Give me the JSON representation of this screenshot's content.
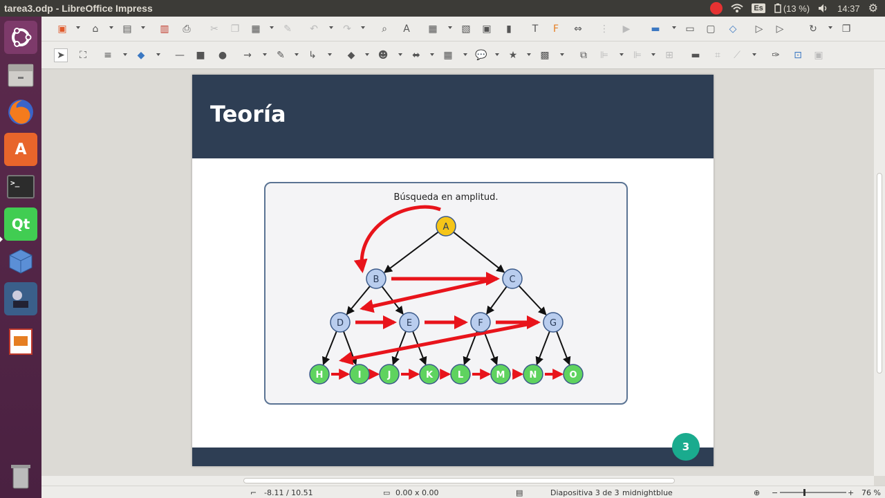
{
  "window": {
    "title": "tarea3.odp - LibreOffice Impress"
  },
  "tray": {
    "keyboard": "Es",
    "battery": "(13 %)",
    "time": "14:37"
  },
  "slide": {
    "title": "Teoría",
    "number": "3",
    "diagram": {
      "caption": "Búsqueda en amplitud.",
      "nodes": [
        {
          "id": "A",
          "level": 0,
          "color": "#f5c518"
        },
        {
          "id": "B",
          "level": 1,
          "color": "#b9cdee"
        },
        {
          "id": "C",
          "level": 1,
          "color": "#b9cdee"
        },
        {
          "id": "D",
          "level": 2,
          "color": "#b9cdee"
        },
        {
          "id": "E",
          "level": 2,
          "color": "#b9cdee"
        },
        {
          "id": "F",
          "level": 2,
          "color": "#b9cdee"
        },
        {
          "id": "G",
          "level": 2,
          "color": "#b9cdee"
        },
        {
          "id": "H",
          "level": 3,
          "color": "#5fd35f"
        },
        {
          "id": "I",
          "level": 3,
          "color": "#5fd35f"
        },
        {
          "id": "J",
          "level": 3,
          "color": "#5fd35f"
        },
        {
          "id": "K",
          "level": 3,
          "color": "#5fd35f"
        },
        {
          "id": "L",
          "level": 3,
          "color": "#5fd35f"
        },
        {
          "id": "M",
          "level": 3,
          "color": "#5fd35f"
        },
        {
          "id": "N",
          "level": 3,
          "color": "#5fd35f"
        },
        {
          "id": "O",
          "level": 3,
          "color": "#5fd35f"
        }
      ],
      "edges": [
        [
          "A",
          "B"
        ],
        [
          "A",
          "C"
        ],
        [
          "B",
          "D"
        ],
        [
          "B",
          "E"
        ],
        [
          "C",
          "F"
        ],
        [
          "C",
          "G"
        ],
        [
          "D",
          "H"
        ],
        [
          "D",
          "I"
        ],
        [
          "E",
          "J"
        ],
        [
          "E",
          "K"
        ],
        [
          "F",
          "L"
        ],
        [
          "F",
          "M"
        ],
        [
          "G",
          "N"
        ],
        [
          "G",
          "O"
        ]
      ],
      "traversal_color": "#e8141b"
    }
  },
  "status": {
    "position": "-8.11 / 10.51",
    "size": "0.00 x 0.00",
    "slide_info": "Diapositiva 3 de 3",
    "master": "midnightblue",
    "zoom": "76 %"
  }
}
